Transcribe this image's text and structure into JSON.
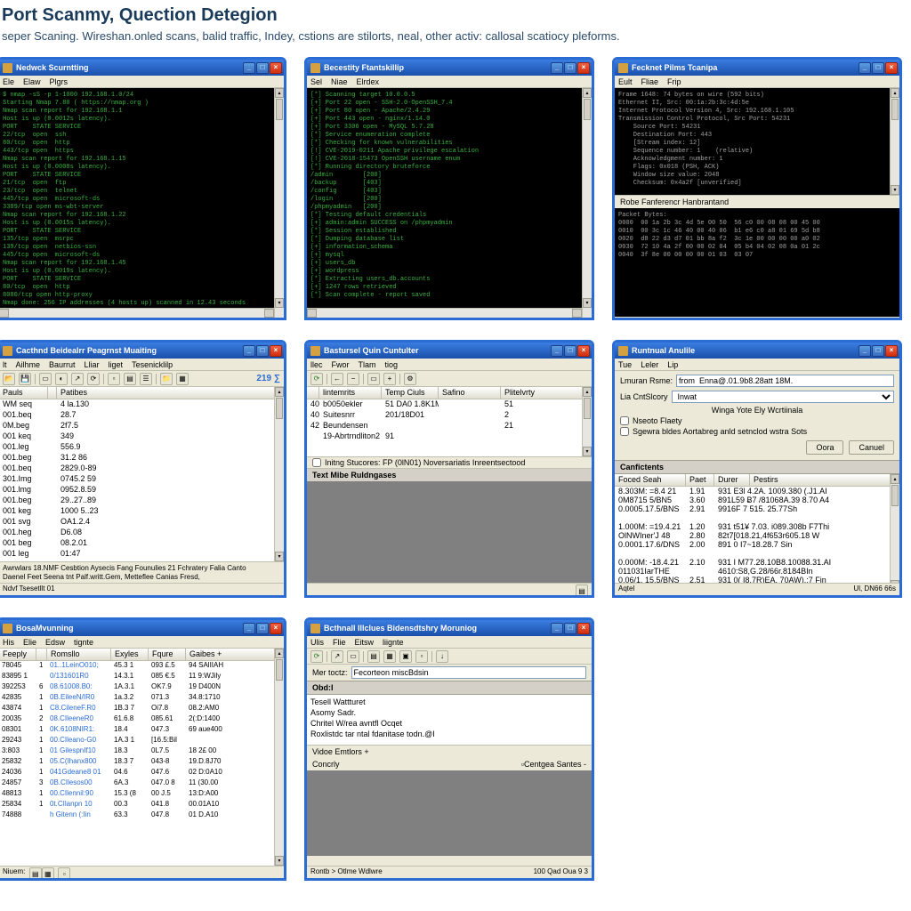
{
  "page": {
    "title": "Port Scanmy, Quection Detegion",
    "subtitle": "seper Scaning. Wireshan.onled scans, balid traffic, Indey, cstions are stilorts, neal, other activ: callosal scatiocy pleforms."
  },
  "row1": {
    "win1": {
      "title": "Nedwck Scurntting",
      "menu": [
        "Ele",
        "Elaw",
        "Plgrs"
      ],
      "term": "$ nmap -sS -p 1-1000 192.168.1.0/24\nStarting Nmap 7.80 ( https://nmap.org )\nNmap scan report for 192.168.1.1\nHost is up (0.0012s latency).\nPORT    STATE SERVICE\n22/tcp  open  ssh\n80/tcp  open  http\n443/tcp open  https\nNmap scan report for 192.168.1.15\nHost is up (0.0008s latency).\nPORT    STATE SERVICE\n21/tcp  open  ftp\n23/tcp  open  telnet\n445/tcp open  microsoft-ds\n3389/tcp open ms-wbt-server\nNmap scan report for 192.168.1.22\nHost is up (0.0015s latency).\nPORT    STATE SERVICE\n135/tcp open  msrpc\n139/tcp open  netbios-ssn\n445/tcp open  microsoft-ds\nNmap scan report for 192.168.1.45\nHost is up (0.0019s latency).\nPORT    STATE SERVICE\n80/tcp  open  http\n8080/tcp open http-proxy\nNmap done: 256 IP addresses (4 hosts up) scanned in 12.43 seconds\n$ "
    },
    "win2": {
      "title": "Becestity Ftantskillip",
      "menu": [
        "Sel",
        "Niae",
        "Elrdex"
      ],
      "term": "[*] Scanning target 10.0.0.5\n[+] Port 22 open - SSH-2.0-OpenSSH_7.4\n[+] Port 80 open - Apache/2.4.29\n[+] Port 443 open - nginx/1.14.0\n[+] Port 3306 open - MySQL 5.7.28\n[*] Service enumeration complete\n[*] Checking for known vulnerabilities\n[!] CVE-2019-0211 Apache privilege escalation\n[!] CVE-2018-15473 OpenSSH username enum\n[*] Running directory bruteforce\n/admin        [200]\n/backup       [403]\n/config       [403]\n/login        [200]\n/phpmyadmin   [200]\n[*] Testing default credentials\n[+] admin:admin SUCCESS on /phpmyadmin\n[*] Session established\n[*] Dumping database list\n[+] information_schema\n[+] mysql\n[+] users_db\n[+] wordpress\n[*] Extracting users_db.accounts\n[+] 1247 rows retrieved\n[*] Scan complete - report saved"
    },
    "win3": {
      "title": "Fecknet Pilms Tcanipa",
      "menu": [
        "Eult",
        "Fliae",
        "Frip"
      ],
      "term_top": "Frame 1648: 74 bytes on wire (592 bits)\nEthernet II, Src: 00:1a:2b:3c:4d:5e\nInternet Protocol Version 4, Src: 192.168.1.105\nTransmission Control Protocol, Src Port: 54231\n    Source Port: 54231\n    Destination Port: 443\n    [Stream index: 12]\n    Sequence number: 1    (relative)\n    Acknowledgment number: 1\n    Flags: 0x018 (PSH, ACK)\n    Window size value: 2048\n    Checksum: 0x4a2f [unverified]",
      "divider": "Robe Fanferencr  Hanbrantand",
      "term_bot": "Packet Bytes:\n0000  00 1a 2b 3c 4d 5e 00 50  56 c0 00 08 08 00 45 00\n0010  00 3c 1c 46 40 00 40 06  b1 e6 c0 a8 01 69 5d b8\n0020  d8 22 d3 d7 01 bb 8a f2  3c 1e 00 00 00 00 a0 02\n0030  72 10 4a 2f 00 00 02 04  05 b4 04 02 08 0a 01 2c\n0040  3f 8e 00 00 00 00 01 03  03 07"
    }
  },
  "row2": {
    "win4": {
      "title": "Cacthnd Beidealrr Peagrnst Muaiting",
      "menu": [
        "lt",
        "Ailhme",
        "Baurrut",
        "Lliar",
        "liget",
        "Tesenicklilp"
      ],
      "tb_text": "219 ∑",
      "cols": [
        "Pauls",
        "",
        "Patibes"
      ],
      "rows": [
        [
          "WM seq",
          "",
          "4 la.130"
        ],
        [
          "001.beq",
          "",
          "28.7"
        ],
        [
          "0M.beg",
          "",
          "2f7.5"
        ],
        [
          "001 keq",
          "",
          "349"
        ],
        [
          "001.leg",
          "",
          "556.9"
        ],
        [
          "001.beg",
          "",
          "31.2 86"
        ],
        [
          "001.beq",
          "",
          "2829.0-89"
        ],
        [
          "301.Img",
          "",
          "0745.2 59"
        ],
        [
          "001.lmg",
          "",
          "0952.8.59"
        ],
        [
          "001.beg",
          "",
          "29..27..89"
        ],
        [
          "001 keg",
          "",
          "1000 5..23"
        ],
        [
          "001 svg",
          "",
          "OA1.2.4"
        ],
        [
          "001.heg",
          "",
          "D6.08"
        ],
        [
          "001 beg",
          "",
          "08.2.01"
        ],
        [
          "001 leg",
          "",
          "01:47"
        ]
      ],
      "status1": "Awrwlars 18.NMF Cesbtion Aysecis Fang Founulies 21 Fchratery Falia Canto\nDaenel Feet Seena tnt Palf.writt.Gem, Metteflee Canias Fresd,",
      "status2": "Ndvf   Tsesetllt  01"
    },
    "win5": {
      "title": "Bastursel Quin Cuntulter",
      "menu": [
        "llec",
        "Fwor",
        "Tlam",
        "tiog"
      ],
      "cols": [
        "lintemrits",
        "Temp Ciuls",
        "Safino",
        "",
        "Plitelvrty"
      ],
      "rows": [
        [
          "40",
          "b0050ekler",
          "51 DA0 1.8K1M",
          "",
          "51"
        ],
        [
          "40",
          "Suitesnrr",
          "201/18D01",
          "",
          "2"
        ],
        [
          "42",
          "Beundensen",
          "",
          "",
          "21"
        ],
        [
          "",
          "19-Abrtrndliton2",
          "91",
          "",
          ""
        ]
      ],
      "check_label": "Initng Stucores:  FP (0lN01)  Noversariatis Inreentsectood",
      "mid_label": "Text Mibe Ruldngases"
    },
    "win6": {
      "title": "Runtnual Anulile",
      "menu": [
        "Tue",
        "Leler",
        "Lip"
      ],
      "form": {
        "label1": "Lmuran Rsme:",
        "val1": "from  Enna@.01.9b8.28att 18M.",
        "label2": "Lia CntSlcory",
        "val2": "Inwat",
        "check_label": "Winga Yote Ely Wcrtiinala"
      },
      "check1": "Nseoto Flaety",
      "check2": "Sgewra bldes Aortabreg anld setnclod wstra Sots",
      "btn_ok": "Oora",
      "btn_cancel": "Canuel",
      "section": "Canfictents",
      "tcols": [
        "Foced Seah",
        "Paet",
        "Durer",
        "",
        "Pestirs"
      ],
      "trows": [
        [
          "8.303M:  =8.4 21",
          "1.91",
          "931 E3l  4.2A. 1009.380 (.J1.AI",
          ""
        ],
        [
          "0M8715 5/BN5",
          "3.60",
          "891L59 Ƀ7  /81068A.39 8.70 A4",
          ""
        ],
        [
          "0.0005.17.5/BNS",
          "2.91",
          "9916F 7 515. 25.77Sh",
          ""
        ],
        [
          "",
          "",
          "",
          ""
        ],
        [
          "1.000M:  =19.4.21",
          "1.20",
          "931 t51¥ 7.03. i089.308b F7Thi",
          ""
        ],
        [
          "OlNWIner'J 48",
          "2.80",
          "82t7[018.21,4f653r605.18 W",
          ""
        ],
        [
          "0.0001.17.6/DNS",
          "2.00",
          "891 0 I7~18.28.7 Sin",
          ""
        ],
        [
          "",
          "",
          "",
          ""
        ],
        [
          "0.000M: -18.4.21",
          "2.10",
          "931 I M77.28.10B8.10088.31.AI",
          ""
        ],
        [
          "011031IarTHE",
          "",
          "4610:S8,G.28/66r.8184BIn",
          ""
        ],
        [
          "0.06/1. 15.5/BNS",
          "2.51",
          "931 0( I8.7R)EA. 70AW).:7 Fin",
          ""
        ]
      ],
      "status_l": "Aqtel",
      "status_r": "Ul, DN66 66s"
    }
  },
  "row3": {
    "win7": {
      "title": "BosaMvunning",
      "menu": [
        "His",
        "Elie",
        "Edsw",
        "tignte"
      ],
      "cols": [
        "Feeply",
        "",
        "Romsllo",
        "Exyles",
        "Fqure",
        "Gaibes +"
      ],
      "rows": [
        [
          "78045",
          "1",
          "01..1LeinO010;",
          "45.3 1",
          "093 £.5",
          "94 SAlIIAH"
        ],
        [
          "83895 1",
          "",
          "0/131601R0",
          "14.3.1",
          "085 €.5",
          "11 9:WJily"
        ],
        [
          "392253",
          "6",
          "08.61008.B0:",
          "1A.3.1",
          "OK7.9",
          "19 D400N"
        ],
        [
          "42835",
          "1",
          "0B.EileeN/IR0",
          "1a.3.2",
          "071.3",
          "34.8:1710"
        ],
        [
          "43874",
          "1",
          "C8.CileneF.R0",
          "1B.3 7",
          "Oi7.8",
          "08.2:AM0"
        ],
        [
          "20035",
          "2",
          "08.CIleeneR0",
          "61.6.8",
          "085.61",
          "2(:D:1400"
        ],
        [
          "08301",
          "1",
          "0K.6108NIR1:",
          "18.4",
          "047.3",
          "69 aue400"
        ],
        [
          "29243",
          "1",
          "00.CIleano-G0",
          "1A.3 1",
          "[16.5:Bil",
          ""
        ],
        [
          "3:803",
          "1",
          "01  GilespnIf10",
          "18.3",
          "0L7.5",
          "18 2£ 00"
        ],
        [
          "25832",
          "1",
          "05.C(Ihanx800",
          "18.3 7",
          "043-8",
          "19.D.8J70"
        ],
        [
          "24036",
          "1",
          "041Gdeane8 01",
          "04.6",
          "047.6",
          "02 D:0A10"
        ],
        [
          "24857",
          "3",
          "0B.CIlesos00",
          "6A.3",
          "047.0 8",
          "11 (30.00"
        ],
        [
          "48813",
          "1",
          "00.CIlennil:90",
          "15.3 (8",
          "00 J.5",
          "13:D:A00"
        ],
        [
          "25834",
          "1",
          "0t.CIlanpn 10",
          "00.3",
          "041.8",
          "00.01A10"
        ],
        [
          "74888",
          "",
          "h  Gitenn (:Iin",
          "63.3",
          "047.8",
          "01 D.A10"
        ]
      ],
      "status": "Niuem:"
    },
    "win8": {
      "title": "Bcthnall Illclues Bidensdtshry Moruniog",
      "menu": [
        "Ulis",
        "Flie",
        "Eitsw",
        "liignte"
      ],
      "form_label": "Mer toctz:",
      "form_val": "Fecorteon miscBdsin",
      "section": "Obd:I",
      "tree": [
        "Tesell Wattturet",
        "Asomy Sadr.",
        "Chritel W/rea avntfl Ocqet",
        "Roxlistdc  tar ntal fdanitase todn.@I"
      ],
      "line1": "Vidoe Emtlors +",
      "line2": "Concrly",
      "line2_r": "Centgea Santes -",
      "status_l": "Rontb >  Otlme Wdlwre",
      "status_r": "100 Qad Oua 9 3"
    }
  }
}
